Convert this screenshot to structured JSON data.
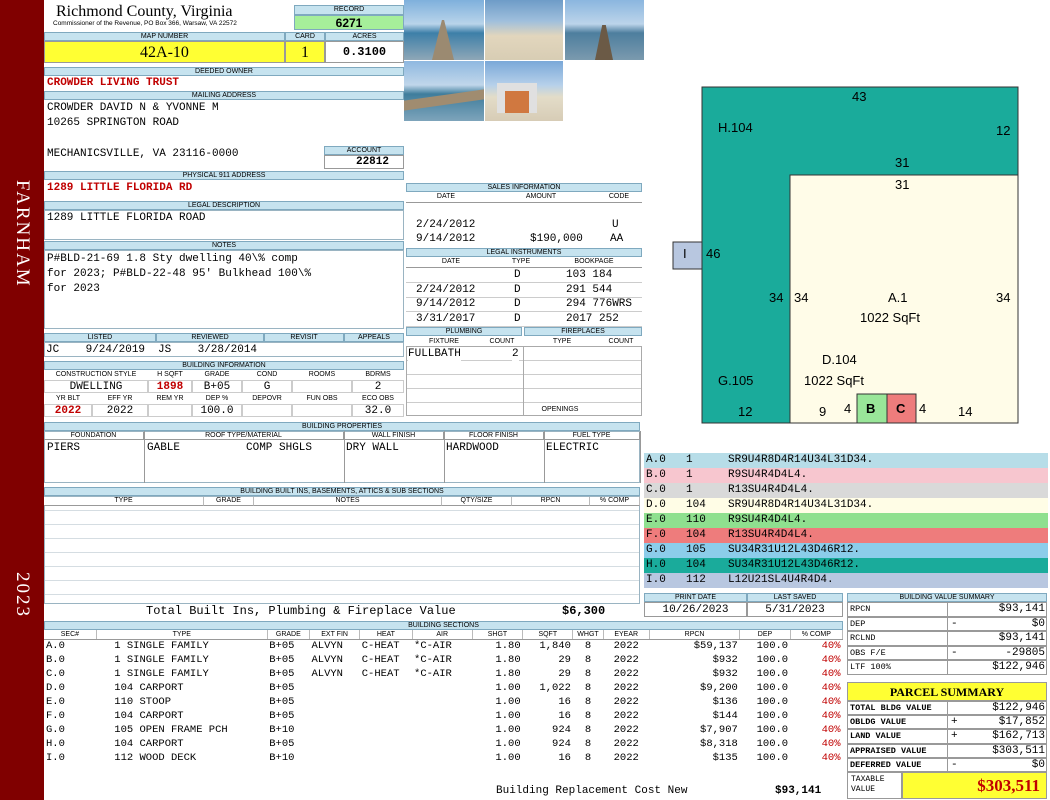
{
  "sidebar": {
    "district": "FARNHAM",
    "year": "2023"
  },
  "header": {
    "county": "Richmond County, Virginia",
    "address": "Commissioner of the Revenue, PO Box 366, Warsaw, VA 22572",
    "record_label": "RECORD",
    "record": "6271",
    "map_label": "MAP NUMBER",
    "map_number": "42A-10",
    "card_label": "CARD",
    "card": "1",
    "acres_label": "ACRES",
    "acres": "0.3100"
  },
  "owner": {
    "deeded_label": "DEEDED OWNER",
    "deeded_owner": "CROWDER LIVING TRUST",
    "mailing_label": "MAILING ADDRESS",
    "mailing_lines": [
      "CROWDER DAVID N & YVONNE M",
      "10265 SPRINGTON ROAD",
      "",
      "MECHANICSVILLE, VA 23116-0000"
    ],
    "account_label": "ACCOUNT",
    "account": "22812",
    "physical_label": "PHYSICAL 911 ADDRESS",
    "physical": "1289 LITTLE FLORIDA RD",
    "legal_label": "LEGAL DESCRIPTION",
    "legal": "1289 LITTLE FLORIDA ROAD",
    "notes_label": "NOTES",
    "notes": [
      "P#BLD-21-69 1.8 Sty dwelling 40\\% comp",
      "for 2023; P#BLD-22-48 95' Bulkhead 100\\%",
      "for 2023"
    ]
  },
  "review": {
    "headers": [
      "LISTED",
      "REVIEWED",
      "REVISIT",
      "APPEALS"
    ],
    "listed": "JC    9/24/2019",
    "reviewed": "JS    3/28/2014"
  },
  "building_info": {
    "title": "BUILDING INFORMATION",
    "headers": [
      "CONSTRUCTION STYLE",
      "H SQFT",
      "GRADE",
      "COND",
      "ROOMS",
      "BDRMS"
    ],
    "values": [
      "DWELLING",
      "1898",
      "B+05",
      "G",
      "",
      "2"
    ],
    "headers2": [
      "YR BLT",
      "EFF YR",
      "REM YR",
      "DEP %",
      "DEPOVR",
      "FUN OBS",
      "ECO OBS"
    ],
    "values2": [
      "2022",
      "2022",
      "",
      "100.0",
      "",
      "",
      "32.0"
    ]
  },
  "properties": {
    "title": "BUILDING PROPERTIES",
    "headers": [
      "FOUNDATION",
      "ROOF TYPE/MATERIAL",
      "WALL FINISH",
      "FLOOR FINISH",
      "FUEL TYPE"
    ],
    "foundation": "PIERS",
    "roof_type": "GABLE",
    "roof_material": "COMP SHGLS",
    "wall": "DRY WALL",
    "floor": "HARDWOOD",
    "fuel": "ELECTRIC"
  },
  "builtins": {
    "title": "BUILDING BUILT INS, BASEMENTS, ATTICS & SUB SECTIONS",
    "headers": [
      "TYPE",
      "GRADE",
      "NOTES",
      "QTY/SIZE",
      "RPCN",
      "% COMP"
    ],
    "total_label": "Total Built Ins, Plumbing & Fireplace Value",
    "total": "$6,300"
  },
  "sales": {
    "title": "SALES INFORMATION",
    "headers": [
      "DATE",
      "AMOUNT",
      "CODE"
    ],
    "rows": [
      [
        "2/24/2012",
        "",
        "U"
      ],
      [
        "9/14/2012",
        "$190,000",
        "AA"
      ]
    ]
  },
  "legal_instruments": {
    "title": "LEGAL INSTRUMENTS",
    "headers": [
      "DATE",
      "TYPE",
      "BOOKPAGE"
    ],
    "rows": [
      [
        "",
        "D",
        "103 184"
      ],
      [
        "2/24/2012",
        "D",
        "291 544"
      ],
      [
        "9/14/2012",
        "D",
        "294 776WRS"
      ],
      [
        "3/31/2017",
        "D",
        "2017 252"
      ]
    ]
  },
  "plumbing": {
    "title": "PLUMBING",
    "headers": [
      "FIXTURE",
      "COUNT"
    ],
    "fixture": "FULLBATH",
    "count": "2"
  },
  "fireplaces": {
    "title": "FIREPLACES",
    "headers": [
      "TYPE",
      "COUNT"
    ],
    "openings_label": "OPENINGS"
  },
  "sketch": {
    "labels": {
      "top": "43",
      "h104": "H.104",
      "right12": "12",
      "n31a": "31",
      "n31b": "31",
      "i": "I",
      "n46": "46",
      "n34a": "34",
      "n34b": "34",
      "a1": "A.1",
      "sqft1": "1022 SqFt",
      "n34c": "34",
      "d104": "D.104",
      "sqft2": "1022 SqFt",
      "g105": "G.105",
      "b": "B",
      "c": "C",
      "n12": "12",
      "n9": "9",
      "n4a": "4",
      "n4b": "4",
      "n14": "14"
    },
    "colors": {
      "teal": "#1aab9b",
      "cream": "#fffce8",
      "green": "#99e699",
      "red": "#ee7c7c",
      "ibox": "#b8c7e0"
    }
  },
  "legend": [
    {
      "code": "A.0",
      "n": "1",
      "desc": "SR9U4R8D4R14U34L31D34.",
      "color": "#b7dde8"
    },
    {
      "code": "B.0",
      "n": "1",
      "desc": "R9SU4R4D4L4.",
      "color": "#f7c6cf"
    },
    {
      "code": "C.0",
      "n": "1",
      "desc": "R13SU4R4D4L4.",
      "color": "#d9d9d9"
    },
    {
      "code": "D.0",
      "n": "104",
      "desc": "SR9U4R8D4R14U34L31D34.",
      "color": "#fffde6"
    },
    {
      "code": "E.0",
      "n": "110",
      "desc": "R9SU4R4D4L4.",
      "color": "#8fe08f"
    },
    {
      "code": "F.0",
      "n": "104",
      "desc": "R13SU4R4D4L4.",
      "color": "#ee7c7c"
    },
    {
      "code": "G.0",
      "n": "105",
      "desc": "SU34R31U12L43D46R12.",
      "color": "#8ccdea"
    },
    {
      "code": "H.0",
      "n": "104",
      "desc": "SU34R31U12L43D46R12.",
      "color": "#1aab9b"
    },
    {
      "code": "I.0",
      "n": "112",
      "desc": "L12U21SL4U4R4D4.",
      "color": "#b8c7e0"
    }
  ],
  "dates": {
    "print_label": "PRINT DATE",
    "print": "10/26/2023",
    "saved_label": "LAST SAVED",
    "saved": "5/31/2023"
  },
  "value_summary": {
    "title": "BUILDING VALUE SUMMARY",
    "rows": [
      [
        "RPCN",
        "",
        "$93,141"
      ],
      [
        "DEP",
        "-",
        "$0"
      ],
      [
        "RCLND",
        "",
        "$93,141"
      ],
      [
        "OBS F/E",
        "-",
        "-29805"
      ],
      [
        "LTF 100%",
        "",
        "$122,946"
      ]
    ]
  },
  "parcel": {
    "title": "PARCEL SUMMARY",
    "rows": [
      [
        "TOTAL BLDG VALUE",
        "",
        "$122,946"
      ],
      [
        "OBLDG VALUE",
        "+",
        "$17,852"
      ],
      [
        "LAND VALUE",
        "+",
        "$162,713"
      ],
      [
        "APPRAISED VALUE",
        "",
        "$303,511"
      ],
      [
        "DEFERRED VALUE",
        "-",
        "$0"
      ]
    ],
    "taxable_label": "TAXABLE VALUE",
    "taxable": "$303,511"
  },
  "sections": {
    "title": "BUILDING SECTIONS",
    "headers": [
      "SEC#",
      "TYPE",
      "GRADE",
      "EXT FIN",
      "HEAT",
      "AIR",
      "SHGT",
      "SQFT",
      "WHGT",
      "EYEAR",
      "RPCN",
      "DEP",
      "% COMP"
    ],
    "rows": [
      [
        "A.0",
        "1 SINGLE FAMILY",
        "B+05",
        "ALVYN",
        "C-HEAT",
        "*C-AIR",
        "1.80",
        "1,840",
        "8",
        "2022",
        "$59,137",
        "100.0",
        "40%"
      ],
      [
        "B.0",
        "1 SINGLE FAMILY",
        "B+05",
        "ALVYN",
        "C-HEAT",
        "*C-AIR",
        "1.80",
        "29",
        "8",
        "2022",
        "$932",
        "100.0",
        "40%"
      ],
      [
        "C.0",
        "1 SINGLE FAMILY",
        "B+05",
        "ALVYN",
        "C-HEAT",
        "*C-AIR",
        "1.80",
        "29",
        "8",
        "2022",
        "$932",
        "100.0",
        "40%"
      ],
      [
        "D.0",
        "104 CARPORT",
        "B+05",
        "",
        "",
        "",
        "1.00",
        "1,022",
        "8",
        "2022",
        "$9,200",
        "100.0",
        "40%"
      ],
      [
        "E.0",
        "110 STOOP",
        "B+05",
        "",
        "",
        "",
        "1.00",
        "16",
        "8",
        "2022",
        "$136",
        "100.0",
        "40%"
      ],
      [
        "F.0",
        "104 CARPORT",
        "B+05",
        "",
        "",
        "",
        "1.00",
        "16",
        "8",
        "2022",
        "$144",
        "100.0",
        "40%"
      ],
      [
        "G.0",
        "105 OPEN FRAME PCH",
        "B+10",
        "",
        "",
        "",
        "1.00",
        "924",
        "8",
        "2022",
        "$7,907",
        "100.0",
        "40%"
      ],
      [
        "H.0",
        "104 CARPORT",
        "B+05",
        "",
        "",
        "",
        "1.00",
        "924",
        "8",
        "2022",
        "$8,318",
        "100.0",
        "40%"
      ],
      [
        "I.0",
        "112 WOOD DECK",
        "B+10",
        "",
        "",
        "",
        "1.00",
        "16",
        "8",
        "2022",
        "$135",
        "100.0",
        "40%"
      ]
    ],
    "footer_label": "Building Replacement Cost New",
    "footer_value": "$93,141"
  }
}
